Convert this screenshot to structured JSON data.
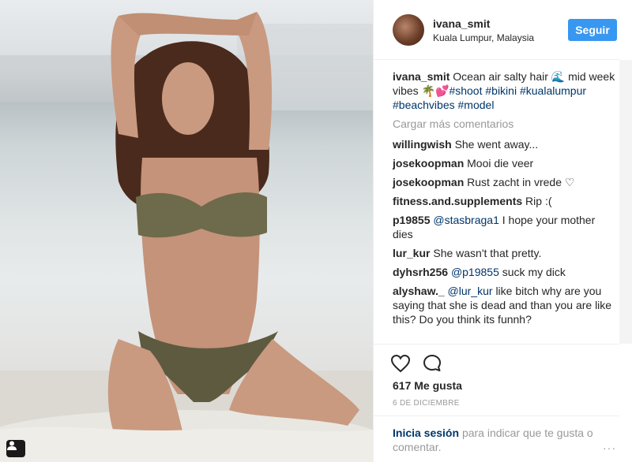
{
  "post": {
    "username": "ivana_smit",
    "location": "Kuala Lumpur, Malaysia",
    "follow_label": "Seguir",
    "caption": {
      "user": "ivana_smit",
      "text": "Ocean air salty hair 🌊 mid week vibes 🌴💕",
      "tags": [
        "#shoot",
        "#bikini",
        "#kualalumpur",
        "#beachvibes",
        "#model"
      ]
    },
    "load_more": "Cargar más comentarios",
    "comments": [
      {
        "user": "willingwish",
        "text": "She went away..."
      },
      {
        "user": "josekoopman",
        "text": "Mooi die veer"
      },
      {
        "user": "josekoopman",
        "text": "Rust zacht in vrede ♡"
      },
      {
        "user": "fitness.and.supplements",
        "text": "Rip :("
      },
      {
        "user": "p19855",
        "mention": "@stasbraga1",
        "text": "I hope your mother dies"
      },
      {
        "user": "lur_kur",
        "text": "She wasn't that pretty."
      },
      {
        "user": "dyhsrh256",
        "mention": "@p19855",
        "text": "suck my dick"
      },
      {
        "user": "alyshaw._",
        "mention": "@lur_kur",
        "text": "like bitch why are you saying that she is dead and than you are like this? Do you think its funnh?"
      }
    ],
    "likes": "617 Me gusta",
    "date": "6 DE DICIEMBRE",
    "login_link": "Inicia sesión",
    "login_rest": "para indicar que te gusta o comentar.",
    "more_label": "···"
  },
  "icons": {
    "heart": "heart-icon",
    "comment": "comment-bubble-icon",
    "user_tag": "user-tag-icon"
  },
  "colors": {
    "accent": "#3897f0",
    "link": "#003569",
    "muted": "#999999"
  }
}
